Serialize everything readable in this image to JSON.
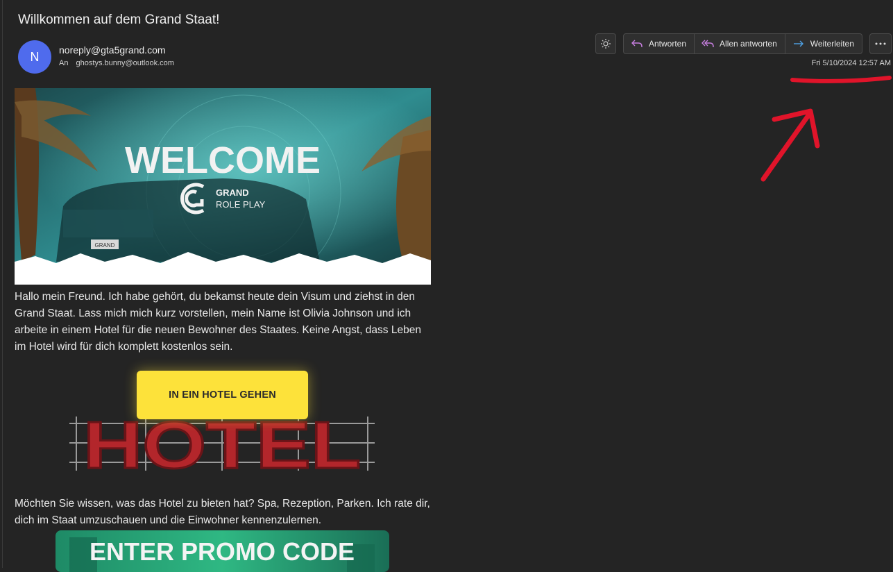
{
  "email": {
    "subject": "Willkommen auf dem Grand Staat!",
    "avatar_initial": "N",
    "from": "noreply@gta5grand.com",
    "to_label": "An",
    "to": "ghostys.bunny@outlook.com",
    "date": "Fri 5/10/2024 12:57 AM"
  },
  "toolbar": {
    "theme_icon": "sun-icon",
    "reply_label": "Antworten",
    "reply_all_label": "Allen antworten",
    "forward_label": "Weiterleiten",
    "more_icon": "ellipsis-icon"
  },
  "content": {
    "hero_title": "WELCOME",
    "hero_brand_line1": "GRAND",
    "hero_brand_line2": "ROLE PLAY",
    "hero_plate": "GRAND",
    "paragraph1": "Hallo mein Freund. Ich habe gehört, du bekamst heute dein Visum und ziehst in den Grand Staat. Lass mich mich kurz vorstellen, mein Name ist Olivia Johnson und ich arbeite in einem Hotel für die neuen Bewohner des Staates. Keine Angst, dass Leben im Hotel wird für dich komplett kostenlos sein.",
    "cta_label": "IN EIN HOTEL GEHEN",
    "hotel_sign": "HOTEL",
    "paragraph2": "Möchten Sie wissen, was das Hotel zu bieten hat? Spa, Rezeption, Parken. Ich rate dir, dich im Staat umzuschauen und die Einwohner kennenzulernen.",
    "promo_title": "ENTER PROMO CODE"
  },
  "colors": {
    "background": "#242424",
    "avatar": "#4f6bed",
    "cta": "#fde23a",
    "annotation": "#e0142a",
    "hotel_letters": "#b3262b"
  }
}
